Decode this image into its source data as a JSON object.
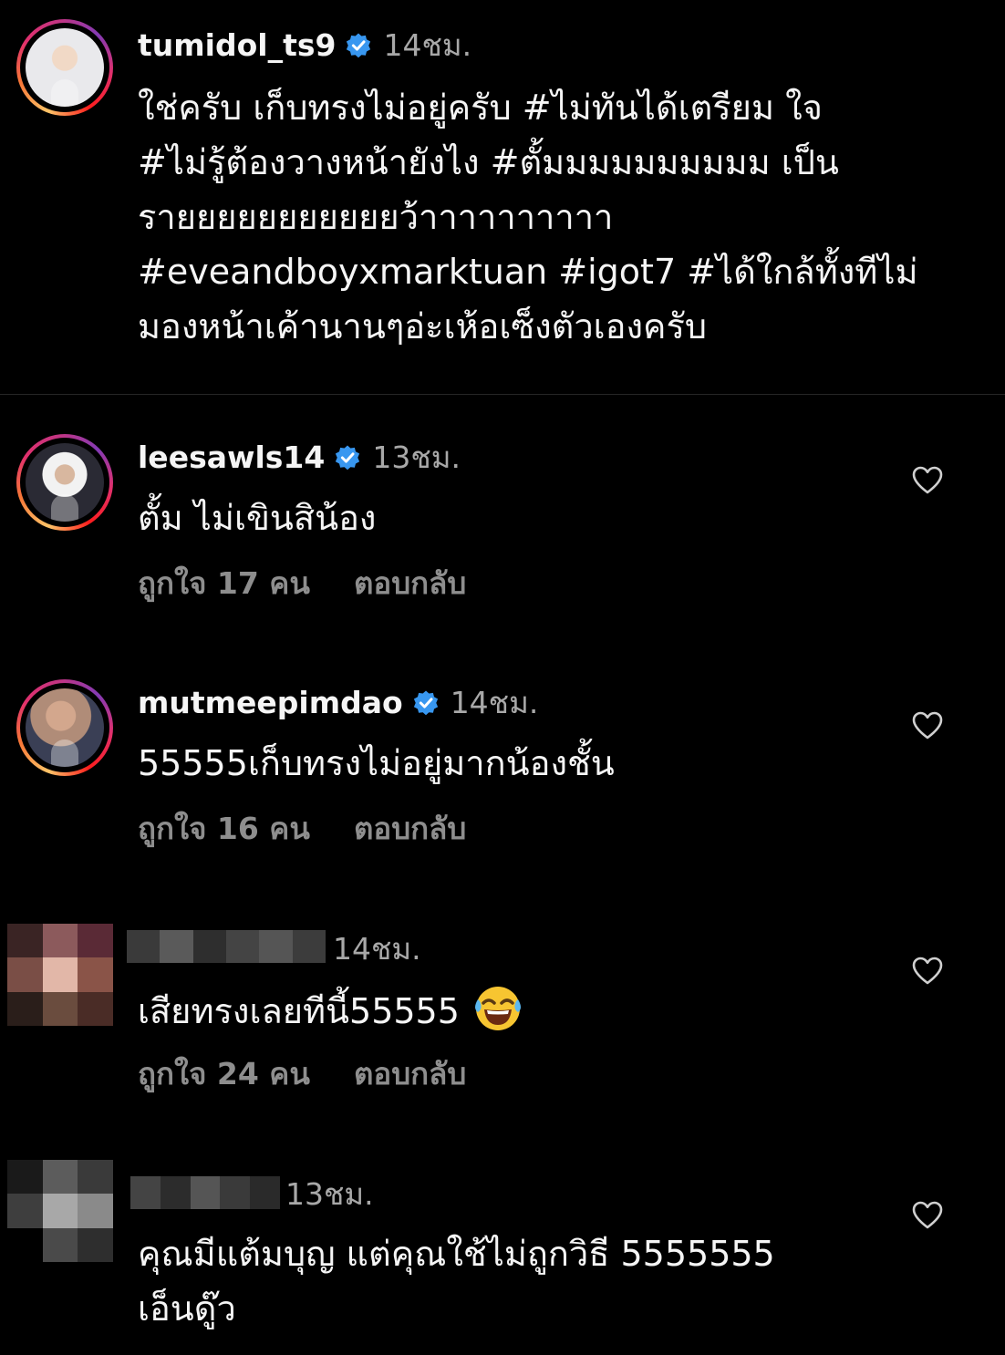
{
  "caption": {
    "username": "tumidol_ts9",
    "time": "14ชม.",
    "lines": [
      "ใช่ครับ เก็บทรงไม่อยู่ครับ #ไม่ทันได้เตรียม ใจ",
      "#ไม่รู้ต้องวางหน้ายังไง #ตั้มมมมมมมมมม เป็น",
      "รายยยยยยยยยยยว้าาาาาาาาาา",
      "#eveandboyxmarktuan #igot7 #ได้ใกล้ทั้งทีไม่",
      "มองหน้าเค้านานๆอ่ะเห้อเซ็งตัวเองครับ"
    ]
  },
  "comments": [
    {
      "username": "leesawls14",
      "verified": true,
      "time": "13ชม.",
      "text": "ตั้ม ไม่เขินสิน้อง",
      "likes": "ถูกใจ 17 คน",
      "reply": "ตอบกลับ"
    },
    {
      "username": "mutmeepimdao",
      "verified": true,
      "time": "14ชม.",
      "text": "55555เก็บทรงไม่อยู่มากน้องชั้น",
      "likes": "ถูกใจ 16 คน",
      "reply": "ตอบกลับ"
    },
    {
      "username": "",
      "verified": false,
      "time": "14ชม.",
      "text": "เสียทรงเลยทีนี้55555",
      "emoji": "face-with-tears-of-joy",
      "likes": "ถูกใจ 24 คน",
      "reply": "ตอบกลับ"
    },
    {
      "username": "",
      "verified": false,
      "time": "13ชม.",
      "text_lines": [
        "คุณมีแต้มบุญ แต่คุณใช้ไม่ถูกวิธี 5555555",
        "เอ็นดู๊ว"
      ]
    }
  ],
  "colors": {
    "background": "#000000",
    "text": "#f5f5f5",
    "muted": "#a8a8a8",
    "meta": "#8e8e8e",
    "verified_badge": "#3897f0",
    "divider": "#262626"
  },
  "icons": [
    "verified-badge-icon",
    "heart-outline-icon",
    "laughing-emoji-icon"
  ]
}
